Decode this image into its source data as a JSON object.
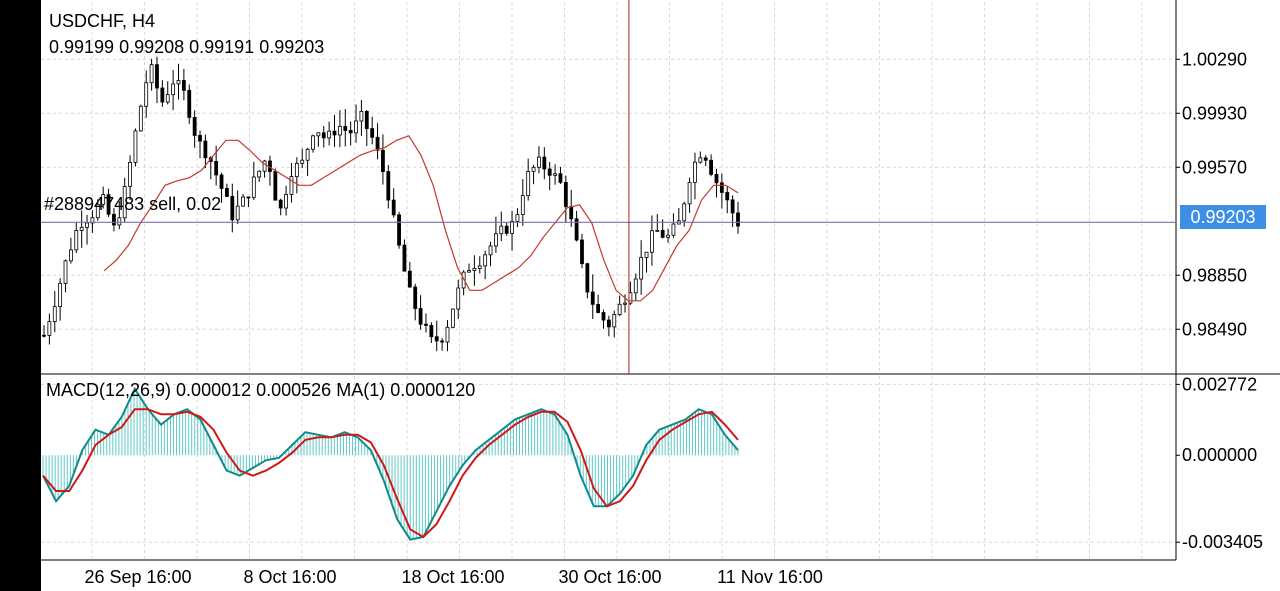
{
  "header": {
    "symbol_timeframe": "USDCHF, H4",
    "ohlc": "0.99199 0.99208 0.99191 0.99203"
  },
  "order_line": {
    "label": "#288947483 sell, 0.02",
    "price": 0.99203
  },
  "current_price_label": "0.99203",
  "macd_header": "MACD(12,26,9) 0.000012 0.000526 MA(1) 0.0000120",
  "colors": {
    "candles": "#000000",
    "ma": "#c0392b",
    "order_line": "#7b6fb0",
    "crosshair": "#b22222",
    "macd_hist": "#5fc8c8",
    "macd_line": "#138a8a",
    "signal_line": "#d01818",
    "price_box": "#3d8fe6",
    "grid": "#d8d8d8"
  },
  "chart_data": [
    {
      "type": "candlestick",
      "title": "USDCHF, H4",
      "y_ticks": [
        "1.00290",
        "0.99930",
        "0.99570",
        "0.98850",
        "0.98490"
      ],
      "y_tick_values": [
        1.0029,
        0.9993,
        0.9957,
        0.9885,
        0.9849
      ],
      "x_ticks": [
        "26 Sep 16:00",
        "8 Oct 16:00",
        "18 Oct 16:00",
        "30 Oct 16:00",
        "11 Nov 16:00"
      ],
      "ylim": [
        0.98205,
        1.00672
      ],
      "grid": true,
      "close_path": [
        0.9845,
        0.987,
        0.9898,
        0.992,
        0.9925,
        0.9935,
        0.9915,
        0.9945,
        0.999,
        1.0025,
        1.0,
        1.0015,
        1.0005,
        0.9975,
        0.9965,
        0.9945,
        0.9925,
        0.9935,
        0.995,
        0.9965,
        0.9925,
        0.9955,
        0.996,
        0.9985,
        0.9975,
        0.9985,
        0.998,
        0.999,
        0.9975,
        0.995,
        0.991,
        0.9875,
        0.9855,
        0.984,
        0.9845,
        0.987,
        0.989,
        0.9895,
        0.9905,
        0.9915,
        0.992,
        0.995,
        0.996,
        0.9955,
        0.9945,
        0.9915,
        0.988,
        0.986,
        0.9852,
        0.9865,
        0.988,
        0.99,
        0.9915,
        0.991,
        0.992,
        0.9955,
        0.997,
        0.995,
        0.9935,
        0.992
      ],
      "ma_path": [
        0.9888,
        0.9895,
        0.9905,
        0.992,
        0.9932,
        0.9945,
        0.9948,
        0.995,
        0.9955,
        0.9965,
        0.9975,
        0.9975,
        0.9968,
        0.996,
        0.9955,
        0.995,
        0.9945,
        0.9945,
        0.995,
        0.9955,
        0.996,
        0.9965,
        0.9968,
        0.997,
        0.9975,
        0.9978,
        0.9965,
        0.9945,
        0.9915,
        0.989,
        0.9875,
        0.9875,
        0.988,
        0.9885,
        0.989,
        0.9898,
        0.991,
        0.992,
        0.993,
        0.9932,
        0.992,
        0.9895,
        0.9875,
        0.9868,
        0.9868,
        0.9875,
        0.989,
        0.9905,
        0.9915,
        0.9935,
        0.9945,
        0.9945,
        0.994
      ],
      "crosshair_x_fraction": 0.518
    },
    {
      "type": "line",
      "title": "MACD(12,26,9) 0.000012 0.000526 MA(1) 0.0000120",
      "y_ticks": [
        "0.002772",
        "0.000000",
        "-0.003405"
      ],
      "y_tick_values": [
        0.002772,
        0.0,
        -0.003405
      ],
      "ylim": [
        -0.0041,
        0.0031
      ],
      "series": [
        {
          "name": "MACD",
          "values": [
            -0.0008,
            -0.0018,
            -0.0012,
            0.0002,
            0.001,
            0.0008,
            0.0015,
            0.0026,
            0.0018,
            0.0012,
            0.0016,
            0.0018,
            0.0014,
            0.0004,
            -0.0006,
            -0.0008,
            -0.0005,
            -0.0002,
            -0.0001,
            0.0004,
            0.0009,
            0.0008,
            0.0007,
            0.0009,
            0.0007,
            0.0002,
            -0.001,
            -0.0025,
            -0.0033,
            -0.0032,
            -0.0022,
            -0.0012,
            -0.0004,
            0.0002,
            0.0006,
            0.001,
            0.0014,
            0.0016,
            0.0018,
            0.0016,
            0.0008,
            -0.0008,
            -0.002,
            -0.002,
            -0.0015,
            -0.0008,
            0.0004,
            0.001,
            0.0012,
            0.0014,
            0.0018,
            0.0016,
            0.0008,
            0.0002
          ]
        },
        {
          "name": "Signal",
          "values": [
            -0.0008,
            -0.0014,
            -0.0014,
            -0.0006,
            0.0004,
            0.0008,
            0.0011,
            0.0018,
            0.0018,
            0.0016,
            0.0016,
            0.0017,
            0.0015,
            0.001,
            0.0001,
            -0.0006,
            -0.0008,
            -0.0006,
            -0.0003,
            0.0001,
            0.0006,
            0.0007,
            0.0007,
            0.0008,
            0.0008,
            0.0005,
            -0.0004,
            -0.0017,
            -0.0029,
            -0.0032,
            -0.0027,
            -0.0018,
            -0.0008,
            -0.0001,
            0.0004,
            0.0008,
            0.0012,
            0.0015,
            0.0017,
            0.0017,
            0.0013,
            0.0002,
            -0.0013,
            -0.002,
            -0.0018,
            -0.0012,
            -0.0002,
            0.0006,
            0.001,
            0.0013,
            0.0016,
            0.0017,
            0.0012,
            0.0006
          ]
        }
      ]
    }
  ]
}
